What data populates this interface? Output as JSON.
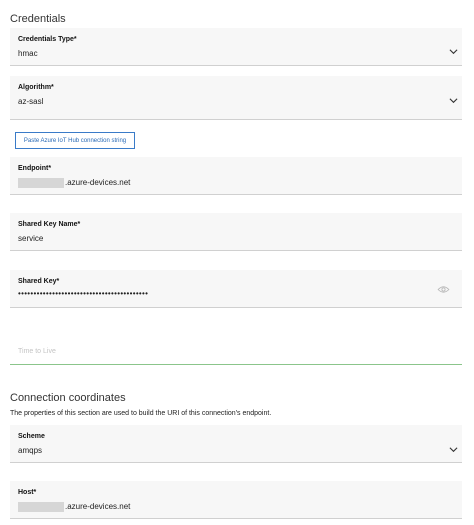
{
  "credentials": {
    "title": "Credentials",
    "credentials_type": {
      "label": "Credentials Type*",
      "value": "hmac"
    },
    "algorithm": {
      "label": "Algorithm*",
      "value": "az-sasl"
    },
    "paste_button": "Paste Azure IoT Hub connection string",
    "endpoint": {
      "label": "Endpoint*",
      "value_suffix": ".azure-devices.net"
    },
    "shared_key_name": {
      "label": "Shared Key Name*",
      "value": "service"
    },
    "shared_key": {
      "label": "Shared Key*",
      "value": "••••••••••••••••••••••••••••••••••••••••••"
    },
    "ttl": {
      "placeholder": "Time to Live"
    }
  },
  "connection": {
    "title": "Connection coordinates",
    "description": "The properties of this section are used to build the URI of this connection's endpoint.",
    "scheme": {
      "label": "Scheme",
      "value": "amqps"
    },
    "host": {
      "label": "Host*",
      "value_suffix": ".azure-devices.net"
    }
  },
  "icons": {
    "dropdown": "chevron-down-icon",
    "visibility": "eye-icon"
  }
}
